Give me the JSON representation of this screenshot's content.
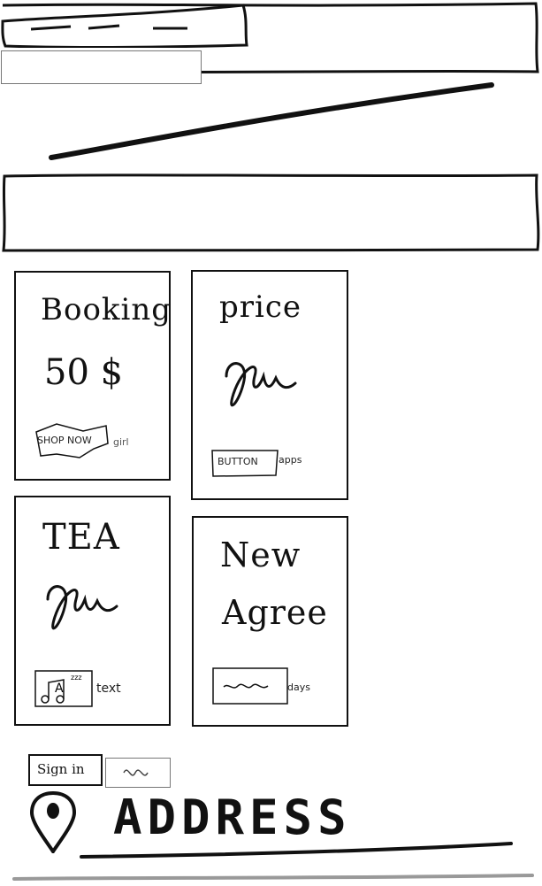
{
  "header": {
    "logo": "logo-scribble",
    "subnav": "",
    "banner": ""
  },
  "cards": [
    {
      "title": "Booking",
      "value": "50 $",
      "button_label": "SHOP NOW",
      "button_note": "girl"
    },
    {
      "title": "price",
      "value": "",
      "button_label": "BUTTON",
      "button_note": "apps"
    },
    {
      "title": "TEA",
      "value": "",
      "button_label": "",
      "button_note": "text"
    },
    {
      "title": "New",
      "subtitle": "Agree",
      "button_label": "",
      "button_note": "days"
    }
  ],
  "footer": {
    "signin_label": "Sign in",
    "address_label": "ADDRESS"
  },
  "icons": {
    "signature": "signature-icon",
    "music": "music-note-icon",
    "map_pin": "map-pin-icon"
  }
}
